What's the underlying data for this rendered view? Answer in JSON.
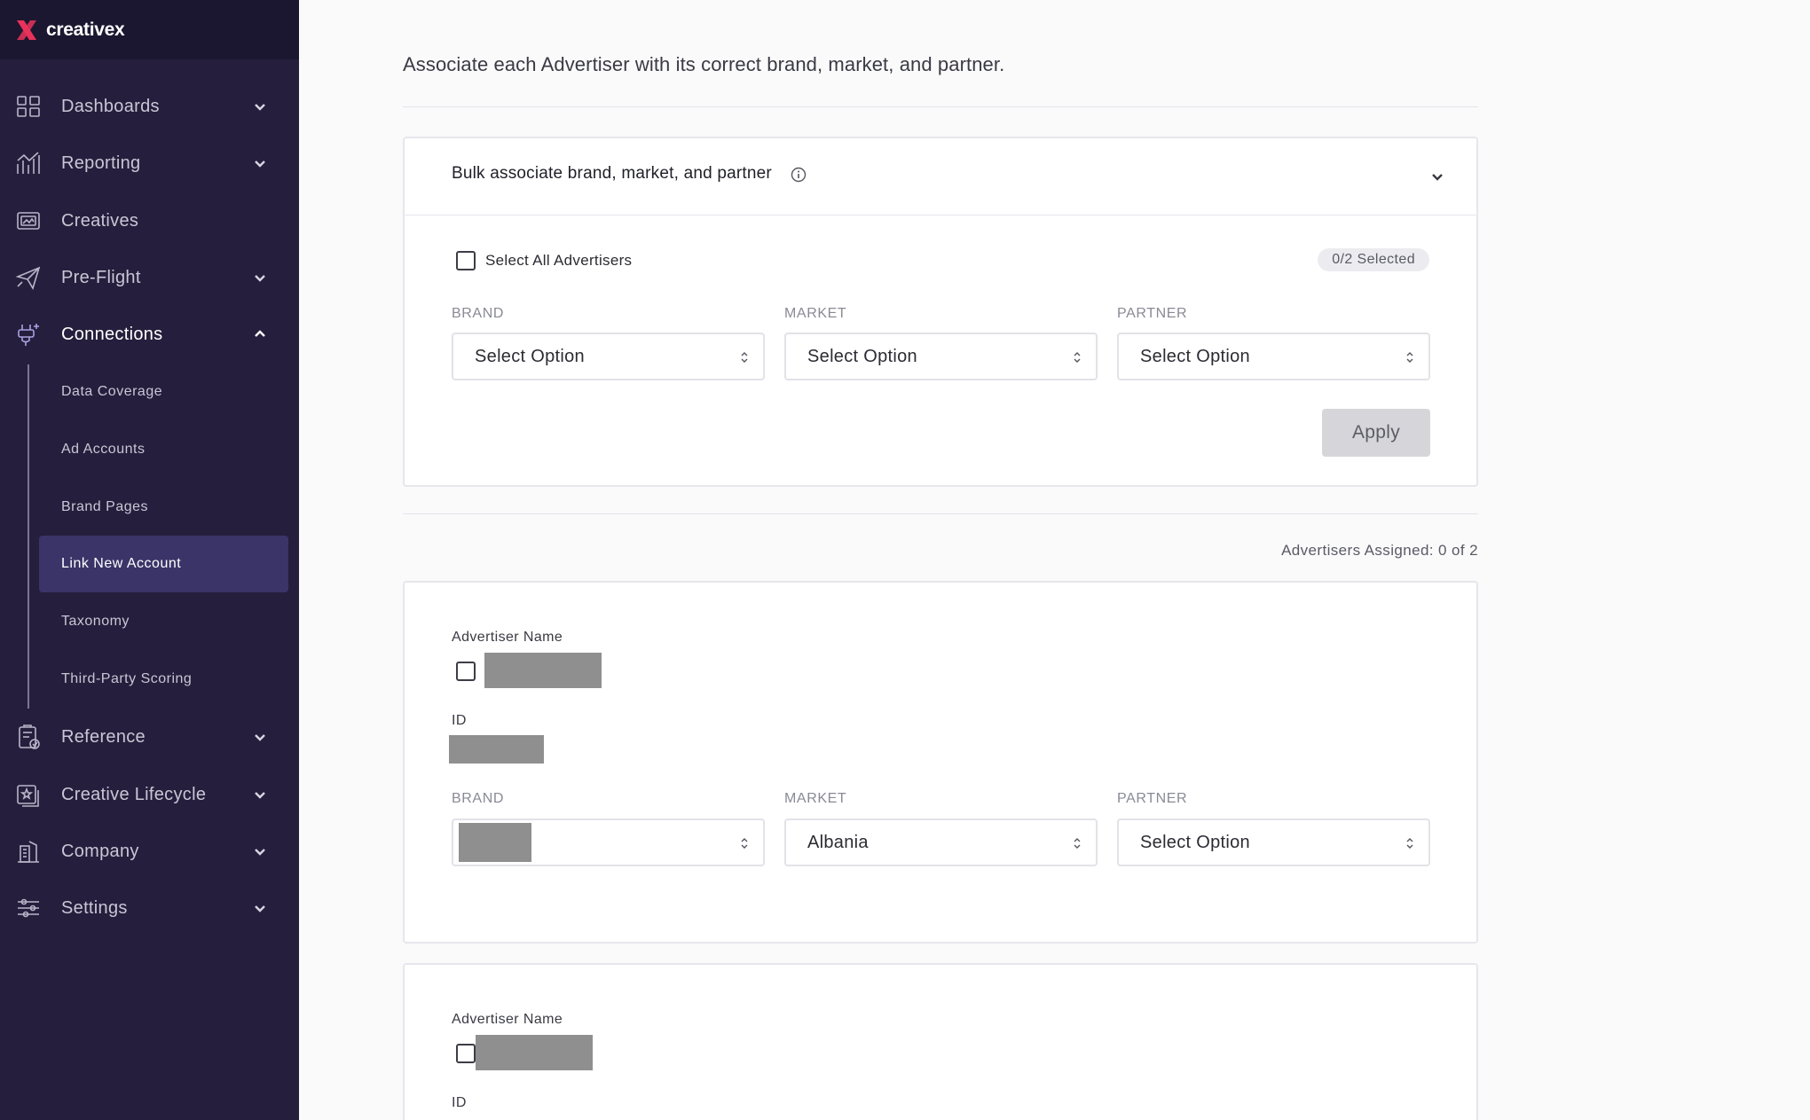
{
  "brand": {
    "logo_text": "creativex"
  },
  "sidebar": {
    "items": [
      {
        "label": "Dashboards",
        "icon": "dashboard-grid-icon",
        "expandable": true
      },
      {
        "label": "Reporting",
        "icon": "bar-chart-icon",
        "expandable": true
      },
      {
        "label": "Creatives",
        "icon": "creatives-icon",
        "expandable": false
      },
      {
        "label": "Pre-Flight",
        "icon": "paper-plane-icon",
        "expandable": true
      },
      {
        "label": "Connections",
        "icon": "plug-icon",
        "expandable": true,
        "expanded": true
      },
      {
        "label": "Reference",
        "icon": "clipboard-check-icon",
        "expandable": true
      },
      {
        "label": "Creative Lifecycle",
        "icon": "lifecycle-icon",
        "expandable": true
      },
      {
        "label": "Company",
        "icon": "building-icon",
        "expandable": true
      },
      {
        "label": "Settings",
        "icon": "sliders-icon",
        "expandable": true
      }
    ],
    "sub_items": [
      {
        "label": "Data Coverage"
      },
      {
        "label": "Ad Accounts"
      },
      {
        "label": "Brand Pages"
      },
      {
        "label": "Link New Account",
        "active": true
      },
      {
        "label": "Taxonomy"
      },
      {
        "label": "Third-Party Scoring"
      }
    ]
  },
  "main": {
    "intro": "Associate each Advertiser with its correct brand, market, and partner.",
    "bulk": {
      "title": "Bulk associate brand, market, and partner",
      "select_all_label": "Select All Advertisers",
      "selected_count": "0/2 Selected",
      "brand_label": "BRAND",
      "market_label": "MARKET",
      "partner_label": "PARTNER",
      "brand_value": "Select Option",
      "market_value": "Select Option",
      "partner_value": "Select Option",
      "apply_label": "Apply"
    },
    "assigned_text": "Advertisers Assigned: 0 of 2",
    "advertisers": [
      {
        "name_label": "Advertiser Name",
        "id_label": "ID",
        "brand_label": "BRAND",
        "market_label": "MARKET",
        "partner_label": "PARTNER",
        "market_value": "Albania",
        "partner_value": "Select Option"
      },
      {
        "name_label": "Advertiser Name",
        "id_label": "ID"
      }
    ]
  },
  "colors": {
    "sidebar_bg": "#251f3d",
    "sidebar_active": "#3b3468",
    "logo_accent": "#e8325a"
  }
}
